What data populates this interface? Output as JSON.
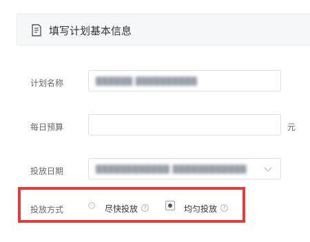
{
  "header": {
    "icon": "document-icon",
    "title": "填写计划基本信息"
  },
  "form": {
    "plan_name": {
      "label": "计划名称",
      "value": "██████ ██████████"
    },
    "daily_budget": {
      "label": "每日预算",
      "value": "",
      "unit": "元"
    },
    "delivery_date": {
      "label": "投放日期",
      "value": "████████████ ████████████"
    },
    "delivery_method": {
      "label": "投放方式",
      "options": [
        {
          "label": "尽快投放",
          "selected": false,
          "help_icon": "question-circle-icon"
        },
        {
          "label": "均匀投放",
          "selected": true,
          "help_icon": "question-circle-icon"
        }
      ]
    }
  },
  "highlight": {
    "color": "#e8393a"
  }
}
